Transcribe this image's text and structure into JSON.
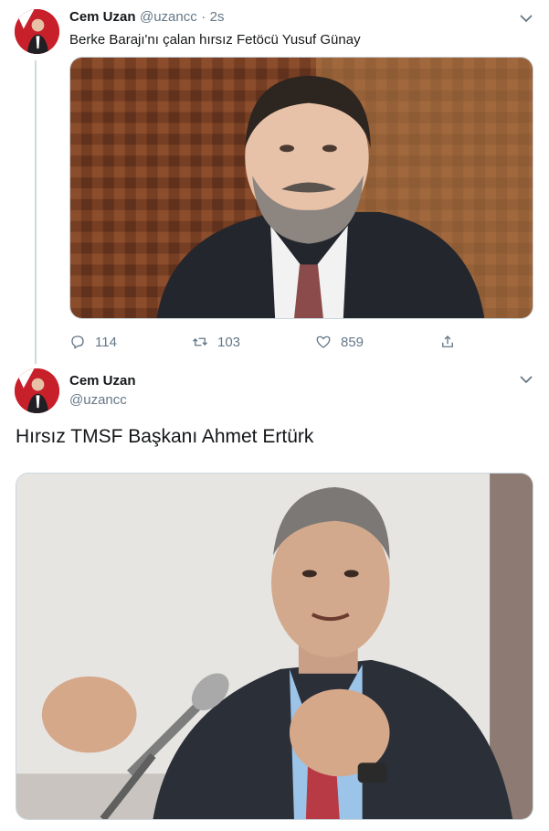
{
  "tweet1": {
    "author_name": "Cem Uzan",
    "handle": "@uzancc",
    "separator": "·",
    "time": "2s",
    "text": "Berke Barajı'nı çalan hırsız Fetöcü Yusuf Günay",
    "actions": {
      "reply_count": "114",
      "retweet_count": "103",
      "like_count": "859"
    }
  },
  "tweet2": {
    "author_name": "Cem Uzan",
    "handle": "@uzancc",
    "text": "Hırsız TMSF Başkanı Ahmet Ertürk"
  },
  "icons": [
    "chevron-down-icon",
    "reply-icon",
    "retweet-icon",
    "like-icon",
    "share-icon"
  ],
  "colors": {
    "text_primary": "#14171a",
    "text_secondary": "#657786",
    "thread_line": "#cfd9de",
    "avatar_red": "#cc1d2a"
  }
}
